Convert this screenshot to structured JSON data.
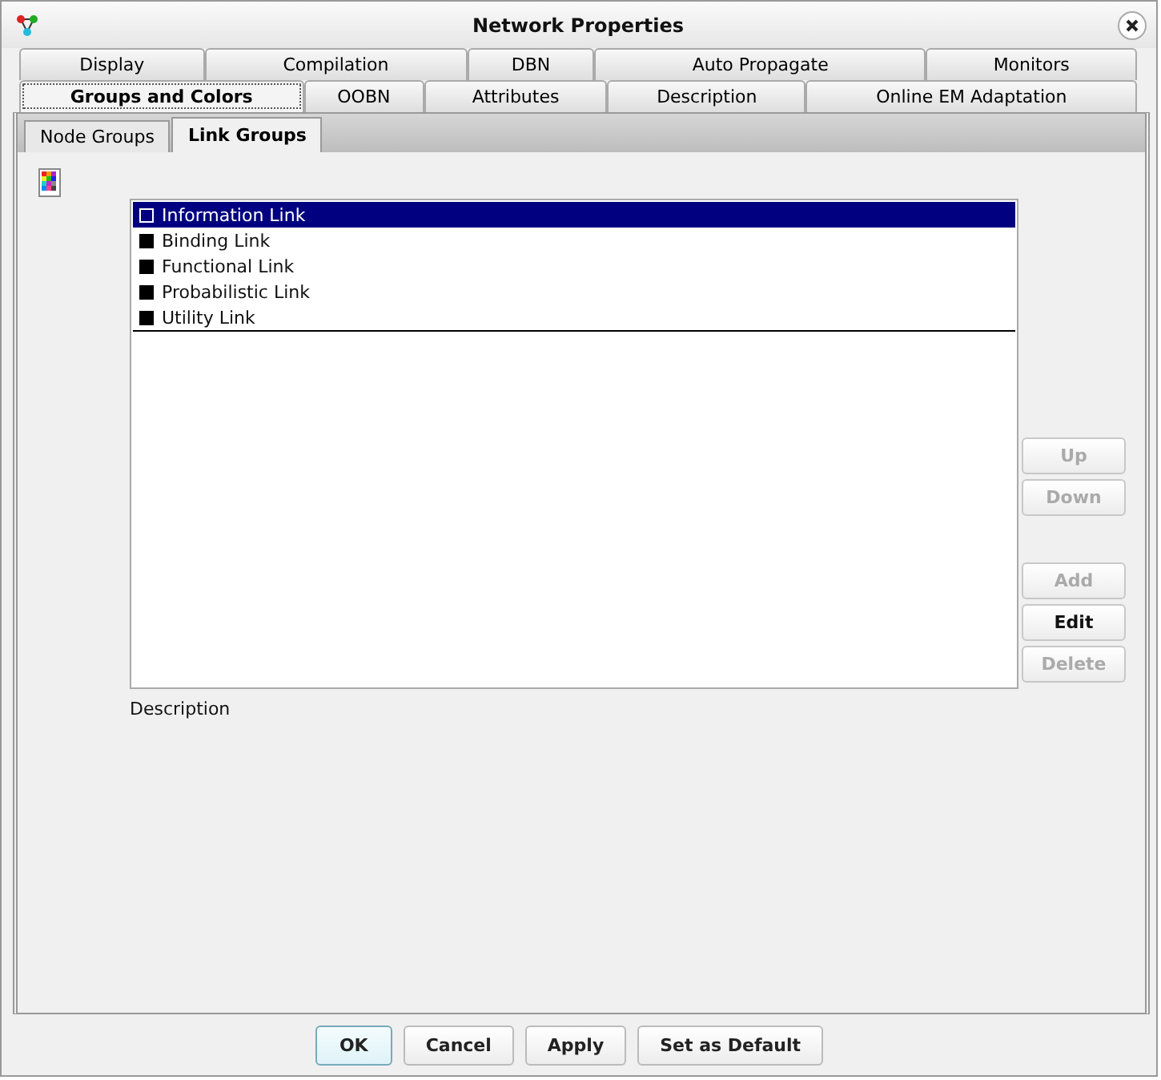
{
  "window": {
    "title": "Network Properties"
  },
  "tab_rows": [
    [
      {
        "label": "Display",
        "selected": false
      },
      {
        "label": "Compilation",
        "selected": false
      },
      {
        "label": "DBN",
        "selected": false
      },
      {
        "label": "Auto Propagate",
        "selected": false
      },
      {
        "label": "Monitors",
        "selected": false
      }
    ],
    [
      {
        "label": "Groups and Colors",
        "selected": true
      },
      {
        "label": "OOBN",
        "selected": false
      },
      {
        "label": "Attributes",
        "selected": false
      },
      {
        "label": "Description",
        "selected": false
      },
      {
        "label": "Online EM Adaptation",
        "selected": false
      }
    ]
  ],
  "subtabs": [
    {
      "label": "Node Groups",
      "selected": false
    },
    {
      "label": "Link Groups",
      "selected": true
    }
  ],
  "groups": [
    {
      "label": "Information Link",
      "selected": true
    },
    {
      "label": "Binding Link",
      "selected": false
    },
    {
      "label": "Functional Link",
      "selected": false
    },
    {
      "label": "Probabilistic Link",
      "selected": false
    },
    {
      "label": "Utility Link",
      "selected": false
    }
  ],
  "side_buttons": [
    {
      "label": "Up",
      "disabled": true
    },
    {
      "label": "Down",
      "disabled": true
    },
    {
      "label": "Add",
      "disabled": true
    },
    {
      "label": "Edit",
      "disabled": false
    },
    {
      "label": "Delete",
      "disabled": true
    }
  ],
  "description_label": "Description",
  "footer_buttons": [
    {
      "label": "OK",
      "default": true
    },
    {
      "label": "Cancel",
      "default": false
    },
    {
      "label": "Apply",
      "default": false
    },
    {
      "label": "Set as Default",
      "default": false
    }
  ]
}
